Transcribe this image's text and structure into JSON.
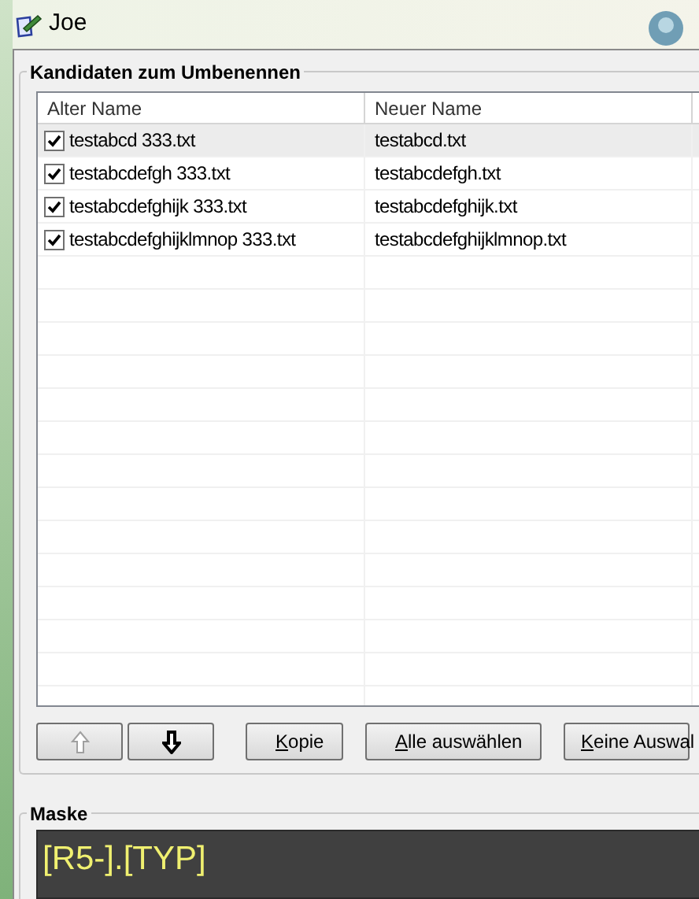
{
  "window": {
    "title": "Joe"
  },
  "candidates": {
    "title": "Kandidaten zum Umbenennen",
    "columns": [
      "Alter Name",
      "Neuer Name"
    ],
    "rows": [
      {
        "old_name": "testabcd 333.txt",
        "new_name": "testabcd.txt",
        "checked": true,
        "selected": true
      },
      {
        "old_name": "testabcdefgh 333.txt",
        "new_name": "testabcdefgh.txt",
        "checked": true,
        "selected": false
      },
      {
        "old_name": "testabcdefghijk 333.txt",
        "new_name": "testabcdefghijk.txt",
        "checked": true,
        "selected": false
      },
      {
        "old_name": "testabcdefghijklmnop 333.txt",
        "new_name": "testabcdefghijklmnop.txt",
        "checked": true,
        "selected": false
      }
    ],
    "buttons": [
      {
        "kind": "up",
        "disabled": true
      },
      {
        "kind": "down",
        "disabled": false
      },
      {
        "kind": "text",
        "label": "Kopie"
      },
      {
        "kind": "text",
        "label": "Alle auswählen"
      },
      {
        "kind": "text",
        "label": "Keine Auswal"
      }
    ]
  },
  "mask": {
    "title": "Maske",
    "value": "[R5-].[TYP]"
  }
}
